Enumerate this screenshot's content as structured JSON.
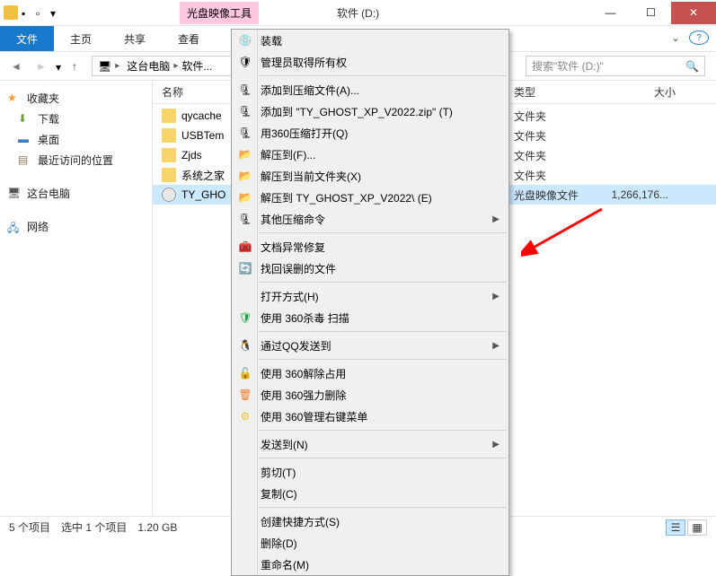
{
  "title": "软件 (D:)",
  "toolName": "光盘映像工具",
  "ribbon": {
    "file": "文件",
    "home": "主页",
    "share": "共享",
    "view": "查看"
  },
  "breadcrumb": {
    "pc": "这台电脑",
    "drive": "软件..."
  },
  "search": {
    "placeholder": "搜索\"软件 (D:)\""
  },
  "sidebar": {
    "fav": "收藏夹",
    "downloads": "下载",
    "desktop": "桌面",
    "recent": "最近访问的位置",
    "pc": "这台电脑",
    "network": "网络"
  },
  "columns": {
    "name": "名称",
    "type": "类型",
    "size": "大小"
  },
  "rows": [
    {
      "name": "qycache",
      "type": "文件夹",
      "size": ""
    },
    {
      "name": "USBTem",
      "type": "文件夹",
      "size": ""
    },
    {
      "name": "Zjds",
      "type": "文件夹",
      "size": ""
    },
    {
      "name": "系统之家",
      "type": "文件夹",
      "size": ""
    },
    {
      "name": "TY_GHO",
      "type": "光盘映像文件",
      "size": "1,266,176..."
    }
  ],
  "ctx": {
    "mount": "装载",
    "admin": "管理员取得所有权",
    "addArchive": "添加到压缩文件(A)...",
    "addZip": "添加到 \"TY_GHOST_XP_V2022.zip\" (T)",
    "open360": "用360压缩打开(Q)",
    "extractTo": "解压到(F)...",
    "extractHere": "解压到当前文件夹(X)",
    "extractNamed": "解压到 TY_GHOST_XP_V2022\\ (E)",
    "otherZip": "其他压缩命令",
    "docRepair": "文档异常修复",
    "findDeleted": "找回误删的文件",
    "openWith": "打开方式(H)",
    "scan360": "使用 360杀毒 扫描",
    "qqSend": "通过QQ发送到",
    "unlock360": "使用 360解除占用",
    "forceDel360": "使用 360强力删除",
    "ctxMenu360": "使用 360管理右键菜单",
    "sendTo": "发送到(N)",
    "cut": "剪切(T)",
    "copy": "复制(C)",
    "shortcut": "创建快捷方式(S)",
    "delete": "删除(D)",
    "rename": "重命名(M)"
  },
  "status": {
    "items": "5 个项目",
    "selected": "选中 1 个项目",
    "size": "1.20 GB"
  }
}
